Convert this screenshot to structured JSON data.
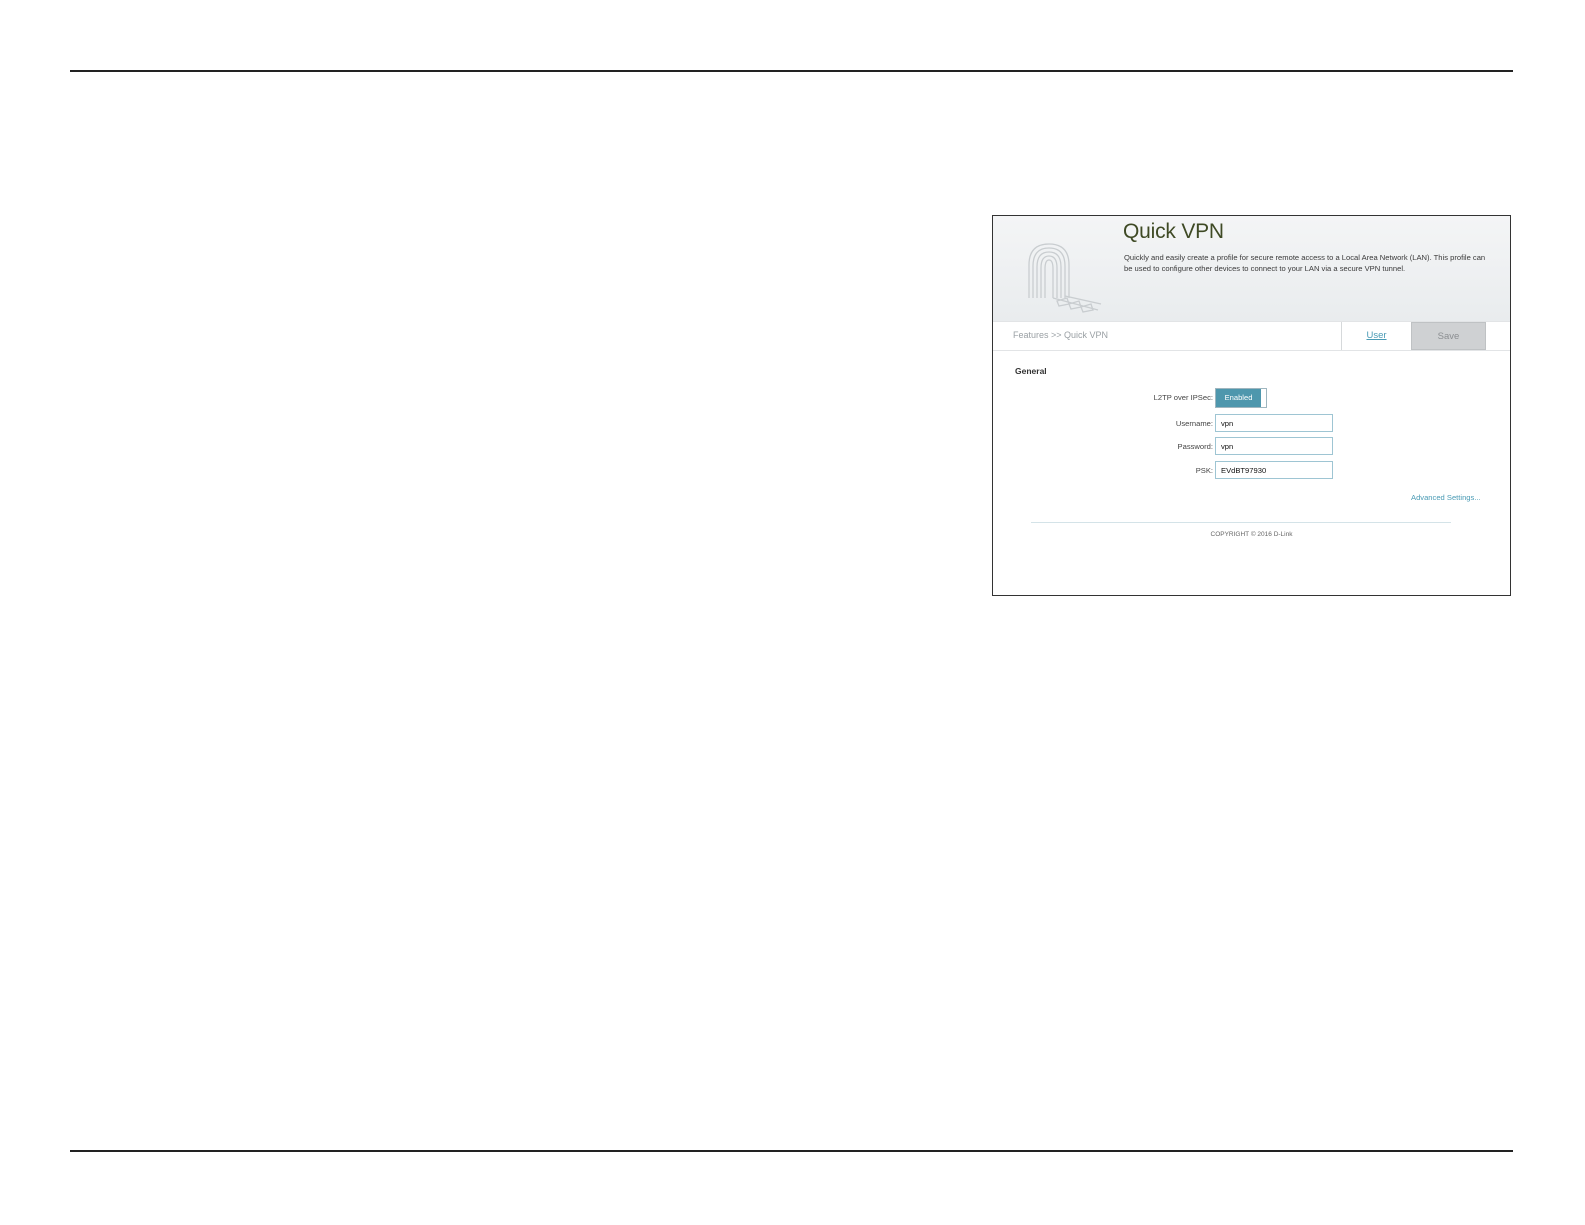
{
  "page": {
    "title": "Quick VPN",
    "description": "Quickly and easily create a profile for secure remote access to a Local Area Network (LAN). This profile can be used to configure other devices to connect to your LAN via a secure VPN tunnel."
  },
  "navbar": {
    "breadcrumb": "Features >> Quick VPN",
    "user_label": "User",
    "save_label": "Save"
  },
  "general": {
    "title": "General",
    "l2tp_label": "L2TP over IPSec:",
    "l2tp_state": "Enabled",
    "username_label": "Username:",
    "username_value": "vpn",
    "password_label": "Password:",
    "password_value": "vpn",
    "psk_label": "PSK:",
    "psk_value": "EVdBT97930"
  },
  "advanced_link": "Advanced Settings...",
  "footer": {
    "copyright": "COPYRIGHT © 2016 D-Link"
  },
  "colors": {
    "accent": "#4e97ad",
    "title": "#3f4a25",
    "save_bg": "#cfd1d3"
  }
}
